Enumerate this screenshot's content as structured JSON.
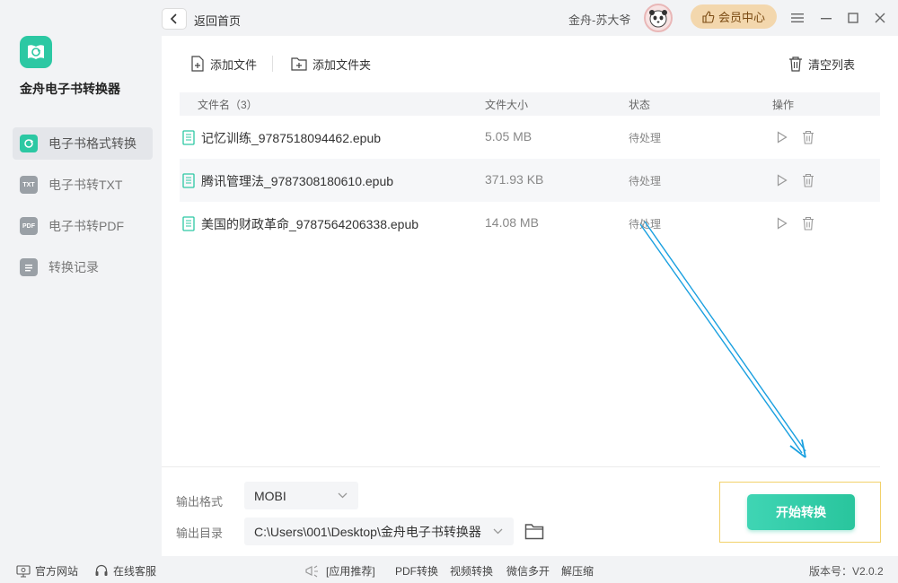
{
  "app": {
    "name": "金舟电子书转换器"
  },
  "sidebar": {
    "items": [
      {
        "label": "电子书格式转换",
        "icon": "convert-icon",
        "active": true
      },
      {
        "label": "电子书转TXT",
        "icon": "txt-icon",
        "icon_text": "TXT"
      },
      {
        "label": "电子书转PDF",
        "icon": "pdf-icon",
        "icon_text": "PDF"
      },
      {
        "label": "转换记录",
        "icon": "record-icon"
      }
    ]
  },
  "topbar": {
    "back_label": "返回首页",
    "user_name": "金舟-苏大爷",
    "vip_label": "会员中心"
  },
  "toolbar": {
    "add_file": "添加文件",
    "add_folder": "添加文件夹",
    "clear_list": "清空列表"
  },
  "table": {
    "headers": {
      "name": "文件名（3）",
      "size": "文件大小",
      "status": "状态",
      "action": "操作"
    },
    "rows": [
      {
        "name": "记忆训练_9787518094462.epub",
        "size": "5.05 MB",
        "status": "待处理"
      },
      {
        "name": "腾讯管理法_9787308180610.epub",
        "size": "371.93 KB",
        "status": "待处理"
      },
      {
        "name": "美国的财政革命_9787564206338.epub",
        "size": "14.08 MB",
        "status": "待处理"
      }
    ]
  },
  "output": {
    "format_label": "输出格式",
    "format_value": "MOBI",
    "dir_label": "输出目录",
    "dir_value": "C:\\Users\\001\\Desktop\\金舟电子书转换器"
  },
  "start_button": "开始转换",
  "statusbar": {
    "website": "官方网站",
    "support": "在线客服",
    "recommend": "[应用推荐]",
    "links": [
      "PDF转换",
      "视频转换",
      "微信多开",
      "解压缩"
    ],
    "version": "版本号：V2.0.2"
  },
  "colors": {
    "accent": "#2cc8a3",
    "vip": "#f3d7ad",
    "arrow": "#1aa0e0",
    "highlight": "#f2d16a"
  }
}
